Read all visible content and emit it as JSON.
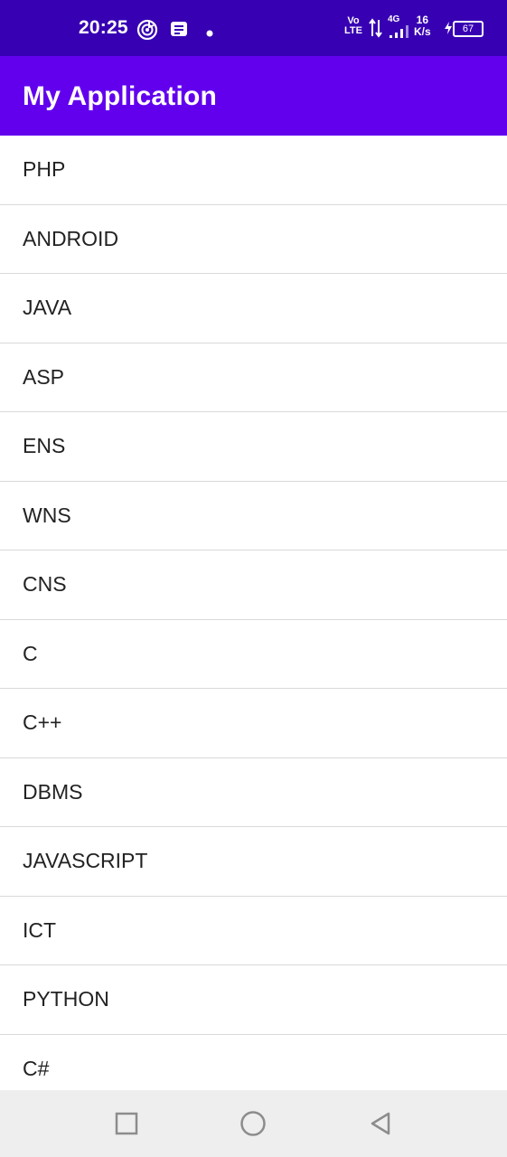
{
  "status_bar": {
    "time": "20:25",
    "volte_top": "Vo",
    "volte_bottom": "LTE",
    "network_type": "4G",
    "speed_value": "16",
    "speed_unit": "K/s",
    "battery_level": "67",
    "icons": [
      "music-app-icon",
      "notification-message-icon",
      "dot-icon",
      "volte-icon",
      "data-arrows-icon",
      "signal-icon",
      "charging-icon",
      "battery-icon"
    ]
  },
  "app_bar": {
    "title": "My Application"
  },
  "list": {
    "items": [
      "PHP",
      "ANDROID",
      "JAVA",
      "ASP",
      "ENS",
      "WNS",
      "CNS",
      "C",
      "C++",
      "DBMS",
      "JAVASCRIPT",
      "ICT",
      "PYTHON",
      "C#"
    ]
  },
  "nav_bar": {
    "icons": [
      "recent-apps-icon",
      "home-icon",
      "back-icon"
    ]
  },
  "colors": {
    "status_bar": "#3700b3",
    "app_bar": "#6200ee",
    "divider": "#d9d9d9",
    "nav_bar": "#eeeeee"
  }
}
